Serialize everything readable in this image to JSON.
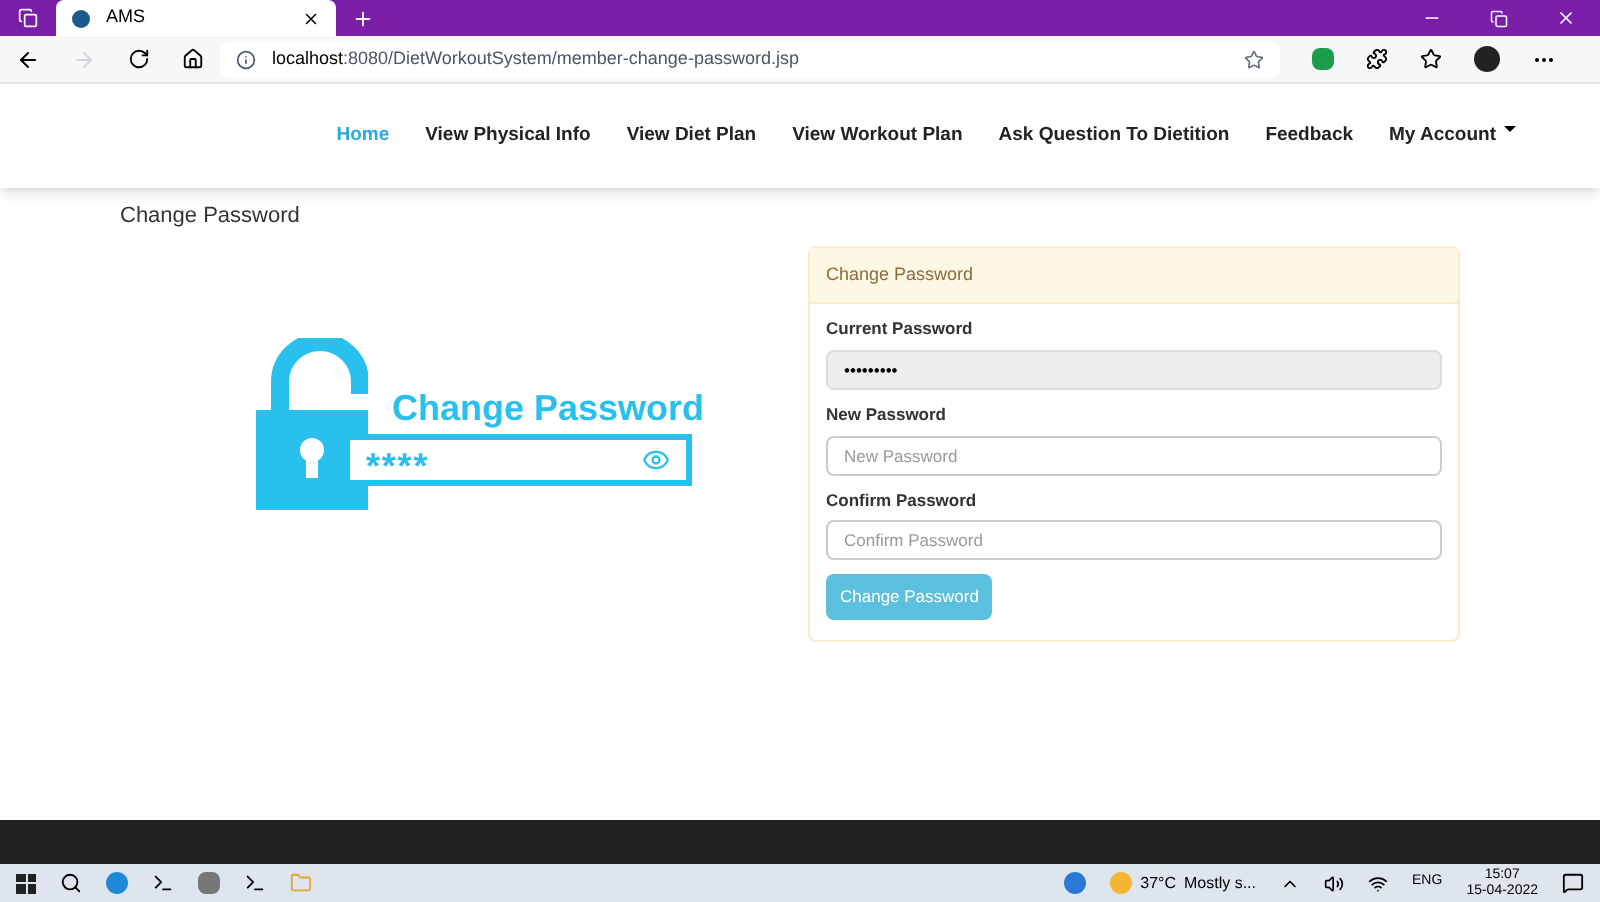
{
  "browser": {
    "tab_title": "AMS",
    "url_host": "localhost",
    "url_rest": ":8080/DietWorkoutSystem/member-change-password.jsp"
  },
  "nav": {
    "items": [
      {
        "label": "Home",
        "selected": true
      },
      {
        "label": "View Physical Info",
        "selected": false
      },
      {
        "label": "View Diet Plan",
        "selected": false
      },
      {
        "label": "View Workout Plan",
        "selected": false
      },
      {
        "label": "Ask Question To Dietition",
        "selected": false
      },
      {
        "label": "Feedback",
        "selected": false
      },
      {
        "label": "My Account",
        "selected": false
      }
    ]
  },
  "page_title": "Change Password",
  "illustration": {
    "title": "Change Password",
    "masked": "****"
  },
  "panel": {
    "heading": "Change Password",
    "fields": [
      {
        "label": "Current Password",
        "value": "•••••••••",
        "disabled": true
      },
      {
        "label": "New Password",
        "placeholder": "New Password",
        "disabled": false
      },
      {
        "label": "Confirm Password",
        "placeholder": "Confirm Password",
        "disabled": false
      }
    ],
    "submit": "Change Password"
  },
  "taskbar": {
    "weather": "37°C",
    "weather_text": "Mostly s...",
    "lang": "ENG",
    "time": "15:07",
    "date": "15-04-2022"
  }
}
